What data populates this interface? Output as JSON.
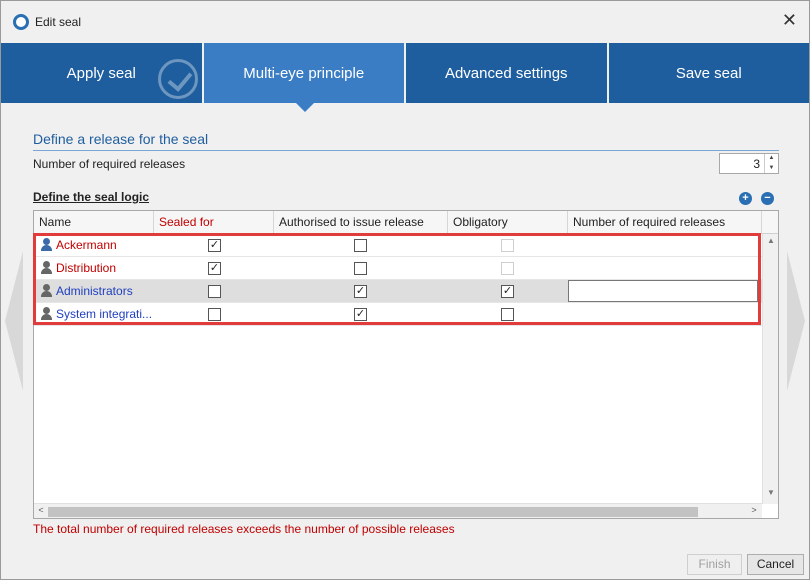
{
  "window": {
    "title": "Edit seal"
  },
  "tabs": [
    {
      "label": "Apply seal"
    },
    {
      "label": "Multi-eye principle"
    },
    {
      "label": "Advanced settings"
    },
    {
      "label": "Save seal"
    }
  ],
  "section": {
    "title": "Define a release for the seal"
  },
  "required_releases": {
    "label": "Number of required releases",
    "value": "3"
  },
  "logic": {
    "label": "Define the seal logic"
  },
  "grid": {
    "columns": [
      "Name",
      "Sealed for",
      "Authorised to issue release",
      "Obligatory",
      "Number of required releases"
    ],
    "rows": [
      {
        "name": "Ackermann",
        "sealed_for": true,
        "authorised": false,
        "obligatory": false,
        "obligatory_disabled": true
      },
      {
        "name": "Distribution",
        "sealed_for": true,
        "authorised": false,
        "obligatory": false,
        "obligatory_disabled": true
      },
      {
        "name": "Administrators",
        "sealed_for": false,
        "authorised": true,
        "obligatory": true,
        "obligatory_disabled": false,
        "required": ""
      },
      {
        "name": "System integrati...",
        "sealed_for": false,
        "authorised": true,
        "obligatory": false,
        "obligatory_disabled": false
      }
    ]
  },
  "error_message": "The total number of required releases exceeds the number of possible releases",
  "buttons": {
    "finish": "Finish",
    "cancel": "Cancel"
  },
  "colors": {
    "tab": "#1f5e9e",
    "tab_active": "#3b7dc4",
    "error": "#c00000",
    "highlight": "#e23b3b"
  }
}
